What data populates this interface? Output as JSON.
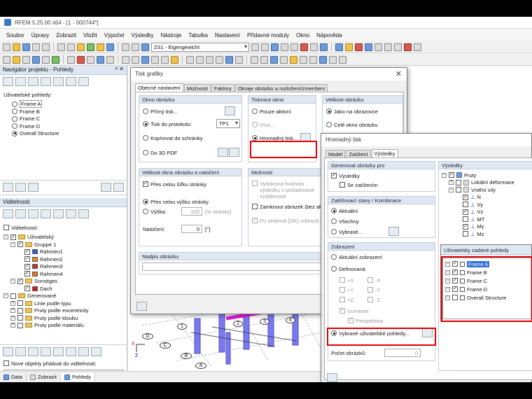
{
  "app": {
    "title": "RFEM 5.25.00 x64 - [1 - 000744*]"
  },
  "menu": [
    "Soubor",
    "Úpravy",
    "Zobrazit",
    "Vložit",
    "Výpočet",
    "Výsledky",
    "Nástroje",
    "Tabulka",
    "Nastavení",
    "Přídavné moduly",
    "Okno",
    "Nápověda"
  ],
  "toolbar": {
    "loadcase": "ZS1 - Eigengewicht"
  },
  "navigator": {
    "title": "Navigátor projektu - Pohledy",
    "views_label": "Uživatelské pohledy:",
    "views": [
      "Frame A",
      "Frame B",
      "Frame C",
      "Frame D",
      "Overall Structure"
    ],
    "selected_view": "Overall Structure",
    "visibility_title": "Viditelnosti",
    "visibility_check": "Viditelnosti:",
    "tree": {
      "user": "Uživatelský",
      "group1": "Gruppe 1",
      "frames": [
        "Rahmen1",
        "Rahmen2",
        "Rahmen3",
        "Rahmen4"
      ],
      "other": "Sonstiges",
      "roof": "Dach",
      "generated": "Generované",
      "gen_items": [
        "Linie podle typu",
        "Pruty podle excentricity",
        "Pruty podle kloubu",
        "Pruty podle materiálu"
      ]
    },
    "new_objects": "Nové objekty přidávat do viditelnosti:",
    "colors": {
      "frame1": "#2e5fc9",
      "frame2": "#e68a1e",
      "frame3": "#c23232",
      "frame4": "#e07a1a",
      "roof": "#d81818"
    }
  },
  "statusbar": [
    "Data",
    "Zobrazit",
    "Pohledy"
  ],
  "print_dialog": {
    "title": "Tisk grafiky",
    "tabs": [
      "Obecné nastavení",
      "Možnosti",
      "Faktory",
      "Okraje obrázku a rozložení/zmenšení"
    ],
    "image_window": {
      "title": "Okno obrázku",
      "options": [
        "Přímý tisk...",
        "Tisk do protokolu:",
        "Kopírovat do schránky",
        "Do 3D PDF"
      ],
      "protocol": "TP1"
    },
    "print_window": {
      "title": "Tisknout okno",
      "options": [
        "Pouze aktivní",
        "Více...",
        "Hromadný tisk..."
      ]
    },
    "image_size": {
      "title": "Velikost obrázku",
      "options": [
        "Jako na obrazovce",
        "Celé okno obrázku"
      ]
    },
    "window_size": {
      "title": "Velikost okna obrázku a natočení",
      "full_width": "Přes celou šířku stránky",
      "full_height": "Přes celou výšku stránky",
      "height_label": "Výška:",
      "height_value": "100",
      "height_unit": "[% stránky]",
      "rotation_label": "Natočení:",
      "rotation_value": "0",
      "rotation_unit": "[°]"
    },
    "options": {
      "title": "Možnosti",
      "opt1": "Vytisknout hodnotu výsledku v požadované vzdálenosti",
      "opt2": "Zamknout obrázek (bez aktualizace)",
      "opt3": "Po stisknutí [OK] zobrazit p..."
    },
    "header": {
      "title": "Nadpis obrázku"
    }
  },
  "batch_dialog": {
    "title": "Hromadný tisk",
    "tabs": [
      "Model",
      "Zatížení",
      "Výsledky"
    ],
    "generate": {
      "title": "Generovat obrázky pro",
      "results": "Výsledky",
      "with_loads": "Se zatížením"
    },
    "load_cases": {
      "title": "Zatěžovací stavy / Kombinace",
      "options": [
        "Aktuální",
        "Všechny",
        "Vybrané..."
      ]
    },
    "display": {
      "title": "Zobrazení",
      "options": [
        "Aktuální zobrazení",
        "Definovaná"
      ],
      "dirs": [
        "+X",
        "-X",
        "+Y",
        "-Y",
        "+Z",
        "-Z"
      ],
      "iso": "Izometrie",
      "persp": "Perspektiva",
      "user_views": "Vybrané uživatelské pohledy..."
    },
    "count_label": "Počet obrázků:",
    "count_value": "0",
    "results": {
      "title": "Výsledky",
      "tree": [
        "Pruty",
        "Lokální deformace",
        "Vnitřní síly",
        "N",
        "Vy",
        "Vz",
        "MT",
        "My",
        "Mz"
      ]
    }
  },
  "user_views_popup": {
    "title": "Uživatelsky zadané pohledy",
    "items": [
      {
        "label": "Frame A",
        "checked": true,
        "selected": true
      },
      {
        "label": "Frame B",
        "checked": true,
        "selected": false
      },
      {
        "label": "Frame C",
        "checked": true,
        "selected": false
      },
      {
        "label": "Frame D",
        "checked": true,
        "selected": false
      },
      {
        "label": "Overall Structure",
        "checked": false,
        "selected": false
      }
    ]
  },
  "canvas": {
    "axis_labels": [
      "1",
      "2",
      "3",
      "4",
      "D",
      "C",
      "B",
      "A"
    ],
    "axes": [
      "X",
      "Z"
    ],
    "colors": {
      "column": "#7a7aee",
      "beam": "#e01ad8"
    }
  }
}
